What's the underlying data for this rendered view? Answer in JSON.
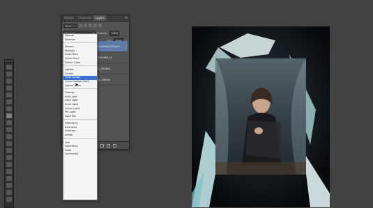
{
  "toolbar": {
    "tools": [
      "move-tool",
      "marquee-tool",
      "lasso-tool",
      "quick-select-tool",
      "crop-tool",
      "eyedropper-tool",
      "healing-tool",
      "brush-tool",
      "clone-tool",
      "history-brush-tool",
      "eraser-tool",
      "gradient-tool",
      "blur-tool",
      "dodge-tool",
      "pen-tool",
      "type-tool",
      "path-select-tool",
      "shape-tool",
      "hand-tool",
      "zoom-tool"
    ],
    "active_index": 7
  },
  "panel": {
    "tabs": [
      "History",
      "Channels",
      "Layers"
    ],
    "active_tab": "Layers",
    "kind_label": "Kind",
    "blend_mode": "Normal",
    "opacity_label": "Opacity:",
    "opacity_value": "100%",
    "fill_label": "Fill:",
    "fill_value": "100%",
    "layers": [
      {
        "name": "1bQAPdzJ-27Sbas1",
        "selected": true
      },
      {
        "name": "f7r0H662_M",
        "selected": false
      },
      {
        "name": "Tu_CR0Ksk",
        "selected": false
      },
      {
        "name": "no_CR0Ksk",
        "selected": false
      }
    ]
  },
  "blend_menu": {
    "groups": [
      [
        "Normal",
        "Dissolve"
      ],
      [
        "Darken",
        "Multiply",
        "Color Burn",
        "Linear Burn",
        "Darker Color"
      ],
      [
        "Lighten",
        "Screen",
        "Color Dodge",
        "Linear Dodge (Add)",
        "Lighter Color"
      ],
      [
        "Overlay",
        "Soft Light",
        "Hard Light",
        "Vivid Light",
        "Linear Light",
        "Pin Light",
        "Hard Mix"
      ],
      [
        "Difference",
        "Exclusion",
        "Subtract",
        "Divide"
      ],
      [
        "Hue",
        "Saturation",
        "Color",
        "Luminosity"
      ]
    ],
    "highlighted": "Color Dodge"
  },
  "colors": {
    "workspace": "#424242",
    "panel": "#535353",
    "selection": "#3b6fd1",
    "selected_layer": "#5e7ba8"
  }
}
